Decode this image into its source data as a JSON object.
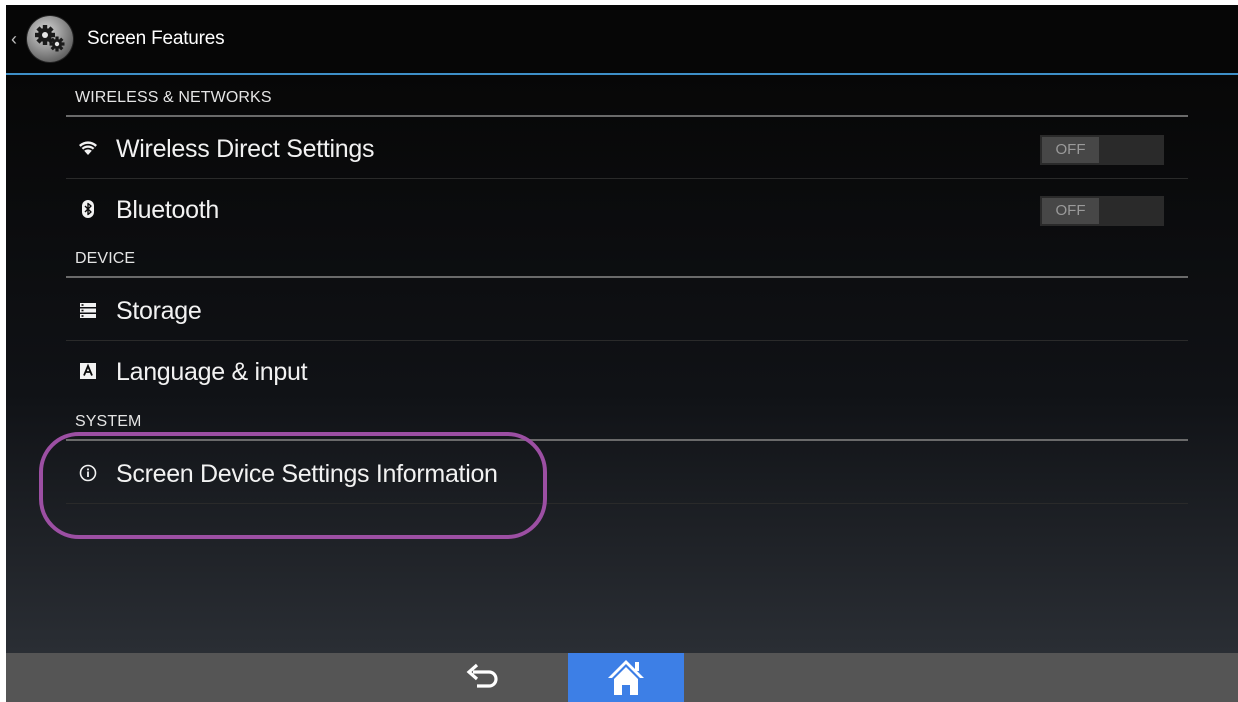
{
  "action_bar": {
    "title": "Screen Features",
    "up_icon": "chevron-left-icon",
    "app_icon": "gears-icon",
    "divider_color": "#3e8fc7"
  },
  "sections": [
    {
      "header": "WIRELESS & NETWORKS",
      "items": [
        {
          "label": "Wireless Direct Settings",
          "icon": "wifi-icon",
          "toggle": "OFF"
        },
        {
          "label": "Bluetooth",
          "icon": "bluetooth-icon",
          "toggle": "OFF"
        }
      ]
    },
    {
      "header": "DEVICE",
      "items": [
        {
          "label": "Storage",
          "icon": "storage-icon"
        },
        {
          "label": "Language & input",
          "icon": "language-icon"
        }
      ]
    },
    {
      "header": "SYSTEM",
      "items": [
        {
          "label": "Screen Device Settings Information",
          "icon": "info-icon"
        }
      ]
    }
  ],
  "annotation": {
    "color": "#9c4fa3",
    "target": "Screen Device Settings Information"
  },
  "nav_bar": {
    "back_icon": "back-arrow-icon",
    "home_icon": "home-icon",
    "home_highlight_color": "#3d7fe6"
  }
}
